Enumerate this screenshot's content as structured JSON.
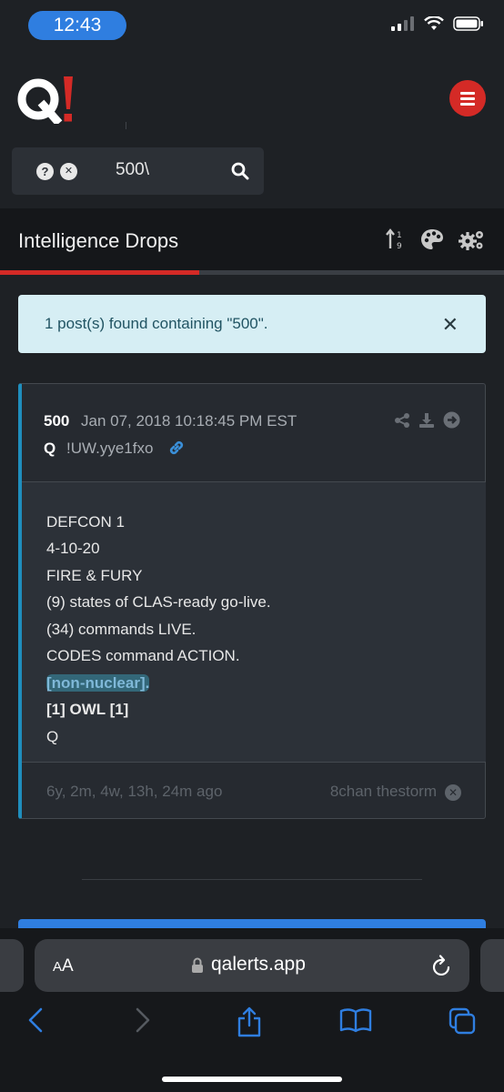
{
  "status": {
    "time": "12:43"
  },
  "search": {
    "query": "500\\",
    "help_glyph": "?",
    "clear_glyph": "✕"
  },
  "page": {
    "title": "Intelligence Drops"
  },
  "alert": {
    "message": "1 post(s) found containing \"500\".",
    "close": "✕"
  },
  "post": {
    "number": "500",
    "date": "Jan 07, 2018 10:18:45 PM EST",
    "author": "Q",
    "trip": "!UW.yye1fxo",
    "lines": [
      "DEFCON 1",
      "4-10-20",
      "FIRE & FURY",
      "(9) states of CLAS-ready go-live.",
      "(34) commands LIVE.",
      "CODES command ACTION.",
      "[non-nuclear].",
      "[1] OWL [1]",
      "Q"
    ],
    "age": "6y, 2m, 4w, 13h, 24m ago",
    "source": "8chan thestorm",
    "source_x": "✕"
  },
  "browser": {
    "aa_small": "A",
    "aa_large": "A",
    "url": "qalerts.app"
  },
  "colors": {
    "accent_red": "#d42a26",
    "accent_blue": "#2f7ee0",
    "post_border": "#1f8ebd"
  }
}
